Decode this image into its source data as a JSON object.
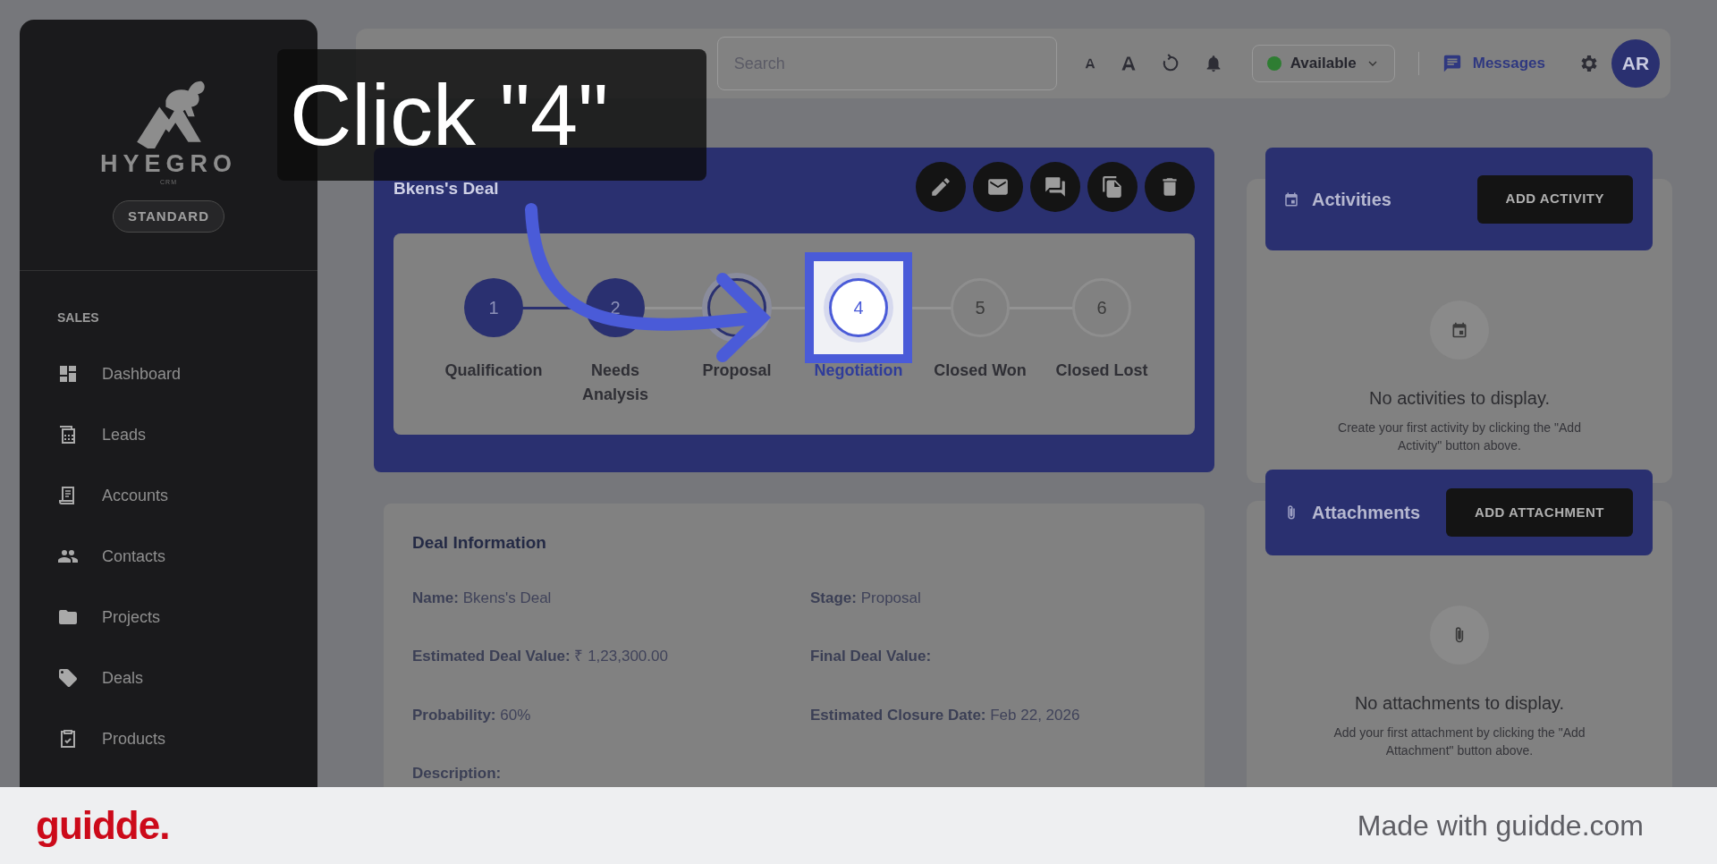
{
  "caption": "Click \"4\"",
  "sidebar": {
    "logo_text": "HYEGRO",
    "logo_sub": "CRM",
    "plan_badge": "STANDARD",
    "section": "SALES",
    "items": [
      {
        "label": "Dashboard"
      },
      {
        "label": "Leads"
      },
      {
        "label": "Accounts"
      },
      {
        "label": "Contacts"
      },
      {
        "label": "Projects"
      },
      {
        "label": "Deals"
      },
      {
        "label": "Products"
      }
    ]
  },
  "topbar": {
    "search": {
      "placeholder": "Search"
    },
    "status": {
      "label": "Available",
      "color": "#2e7d32"
    },
    "messages": "Messages",
    "avatar": "AR"
  },
  "deal": {
    "title": "Bkens's Deal",
    "stages": [
      {
        "number": "1",
        "label": "Qualification",
        "completed": true,
        "current": false,
        "highlighted": false
      },
      {
        "number": "2",
        "label": "Needs Analysis",
        "completed": true,
        "current": false,
        "highlighted": false
      },
      {
        "label": "Proposal",
        "completed": false,
        "current": true,
        "highlighted": false
      },
      {
        "number": "4",
        "label": "Negotiation",
        "completed": false,
        "current": false,
        "highlighted": true
      },
      {
        "number": "5",
        "label": "Closed Won",
        "completed": false,
        "current": false,
        "highlighted": false
      },
      {
        "number": "6",
        "label": "Closed Lost",
        "completed": false,
        "current": false,
        "highlighted": false
      }
    ]
  },
  "deal_information": {
    "title": "Deal Information",
    "fields": [
      {
        "label": "Name:",
        "value": "Bkens's Deal"
      },
      {
        "label": "Stage:",
        "value": "Proposal"
      },
      {
        "label": "Estimated Deal Value:",
        "value": "₹ 1,23,300.00"
      },
      {
        "label": "Final Deal Value:"
      },
      {
        "label": "Probability:",
        "value": "60%"
      },
      {
        "label": "Estimated Closure Date:",
        "value": "Feb 22, 2026"
      },
      {
        "label": "Description:"
      }
    ]
  },
  "activities": {
    "title": "Activities",
    "button": "ADD ACTIVITY",
    "empty_title": "No activities to display.",
    "empty_text": "Create your first activity by clicking the \"Add Activity\" button above."
  },
  "attachments": {
    "title": "Attachments",
    "button": "ADD ATTACHMENT",
    "empty_title": "No attachments to display.",
    "empty_text": "Add your first attachment by clicking the \"Add Attachment\" button above."
  },
  "footer": {
    "logo": "guidde.",
    "credit": "Made with guidde.com"
  }
}
